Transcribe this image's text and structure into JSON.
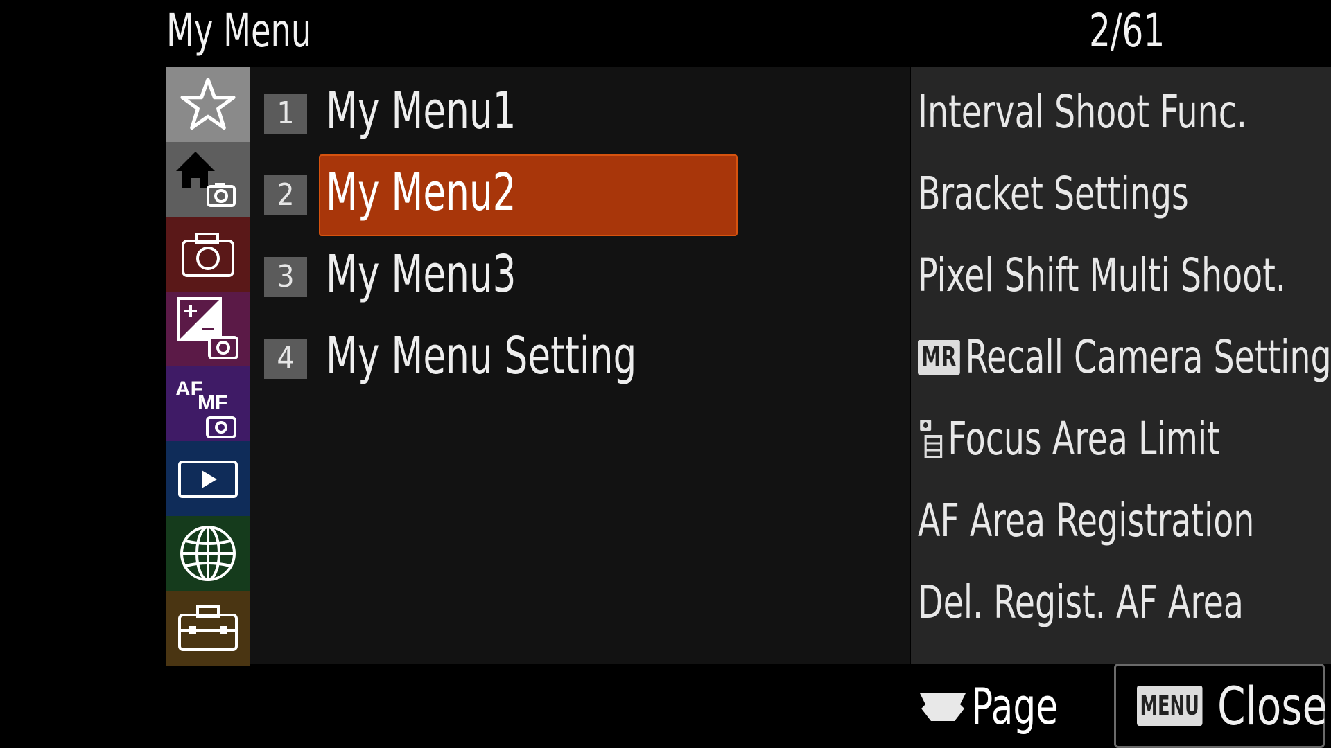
{
  "header": {
    "title": "My Menu",
    "page_indicator": "2/61"
  },
  "tabs": [
    {
      "name": "my-menu",
      "icon": "star-icon",
      "bg": "#8a8a8a"
    },
    {
      "name": "main-camera",
      "icon": "home-camera-icon",
      "bg": "#5e5e5e"
    },
    {
      "name": "shooting",
      "icon": "camera-icon",
      "bg": "#5a1818"
    },
    {
      "name": "exposure",
      "icon": "exposure-compensation-camera-icon",
      "bg": "#5b1a47"
    },
    {
      "name": "focus",
      "icon": "af-mf-camera-icon",
      "bg": "#3f1b66",
      "text_af": "AF",
      "text_mf": "MF"
    },
    {
      "name": "playback",
      "icon": "play-icon",
      "bg": "#0f2c59"
    },
    {
      "name": "network",
      "icon": "globe-icon",
      "bg": "#153b1c"
    },
    {
      "name": "setup",
      "icon": "toolbox-icon",
      "bg": "#4a3512"
    }
  ],
  "submenu": [
    {
      "num": "1",
      "label": "My Menu1"
    },
    {
      "num": "2",
      "label": "My Menu2",
      "selected": true
    },
    {
      "num": "3",
      "label": "My Menu3"
    },
    {
      "num": "4",
      "label": "My Menu Setting"
    }
  ],
  "preview": [
    {
      "label": "Interval Shoot Func."
    },
    {
      "label": "Bracket Settings"
    },
    {
      "label": "Pixel Shift Multi Shoot."
    },
    {
      "badge": "MR",
      "label": "Recall Camera Setting"
    },
    {
      "icon": "photo-movie-icon",
      "label": "Focus Area Limit"
    },
    {
      "label": "AF Area Registration"
    },
    {
      "label": "Del. Regist. AF Area"
    }
  ],
  "footer": {
    "page_label": "Page",
    "page_icon": "control-wheel-icon",
    "menu_badge": "MENU",
    "close_label": "Close"
  },
  "colors": {
    "selection": "#a8360a"
  }
}
